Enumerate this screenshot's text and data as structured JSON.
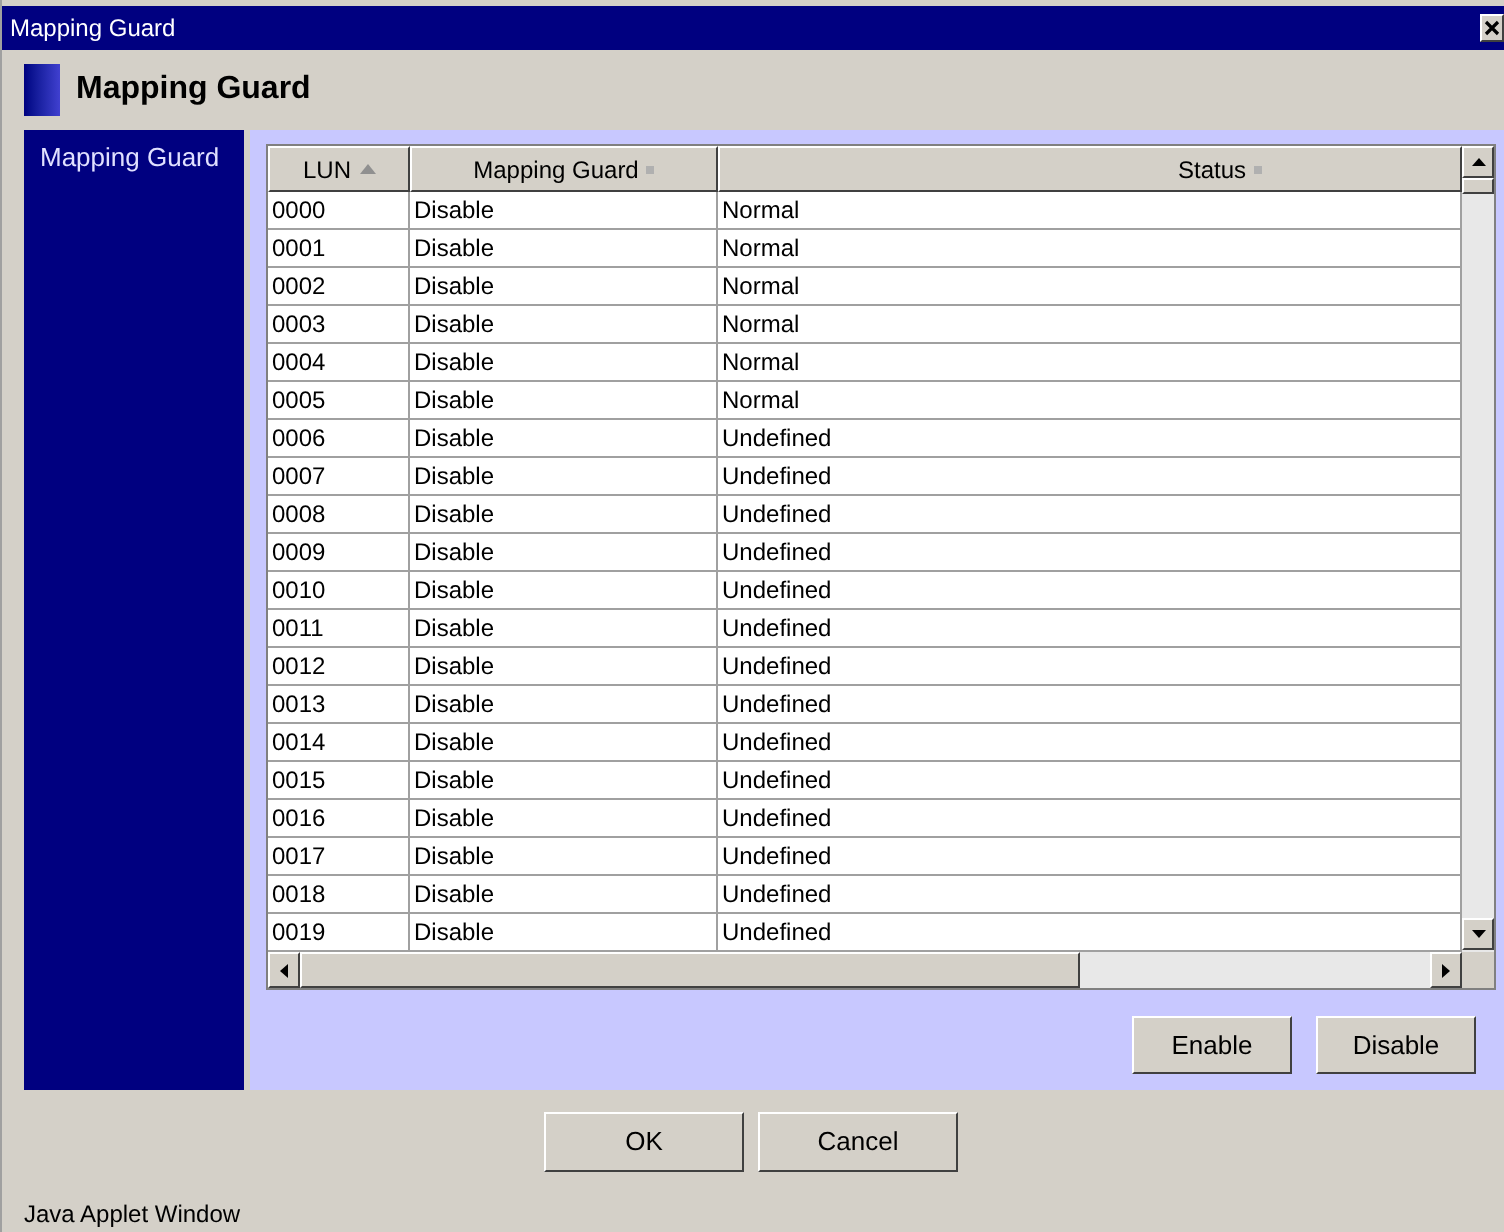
{
  "window": {
    "title": "Mapping Guard"
  },
  "header": {
    "title": "Mapping Guard"
  },
  "sidebar": {
    "items": [
      {
        "label": "Mapping Guard",
        "selected": true
      }
    ]
  },
  "table": {
    "columns": [
      {
        "label": "LUN",
        "sorted": true
      },
      {
        "label": "Mapping Guard",
        "sorted": false
      },
      {
        "label": "Status",
        "sorted": false
      }
    ],
    "rows": [
      [
        "0000",
        "Disable",
        "Normal"
      ],
      [
        "0001",
        "Disable",
        "Normal"
      ],
      [
        "0002",
        "Disable",
        "Normal"
      ],
      [
        "0003",
        "Disable",
        "Normal"
      ],
      [
        "0004",
        "Disable",
        "Normal"
      ],
      [
        "0005",
        "Disable",
        "Normal"
      ],
      [
        "0006",
        "Disable",
        "Undefined"
      ],
      [
        "0007",
        "Disable",
        "Undefined"
      ],
      [
        "0008",
        "Disable",
        "Undefined"
      ],
      [
        "0009",
        "Disable",
        "Undefined"
      ],
      [
        "0010",
        "Disable",
        "Undefined"
      ],
      [
        "0011",
        "Disable",
        "Undefined"
      ],
      [
        "0012",
        "Disable",
        "Undefined"
      ],
      [
        "0013",
        "Disable",
        "Undefined"
      ],
      [
        "0014",
        "Disable",
        "Undefined"
      ],
      [
        "0015",
        "Disable",
        "Undefined"
      ],
      [
        "0016",
        "Disable",
        "Undefined"
      ],
      [
        "0017",
        "Disable",
        "Undefined"
      ],
      [
        "0018",
        "Disable",
        "Undefined"
      ],
      [
        "0019",
        "Disable",
        "Undefined"
      ]
    ]
  },
  "panel_buttons": [
    "Enable",
    "Disable"
  ],
  "dialog_buttons": [
    "OK",
    "Cancel"
  ],
  "status_bar": "Java Applet Window"
}
